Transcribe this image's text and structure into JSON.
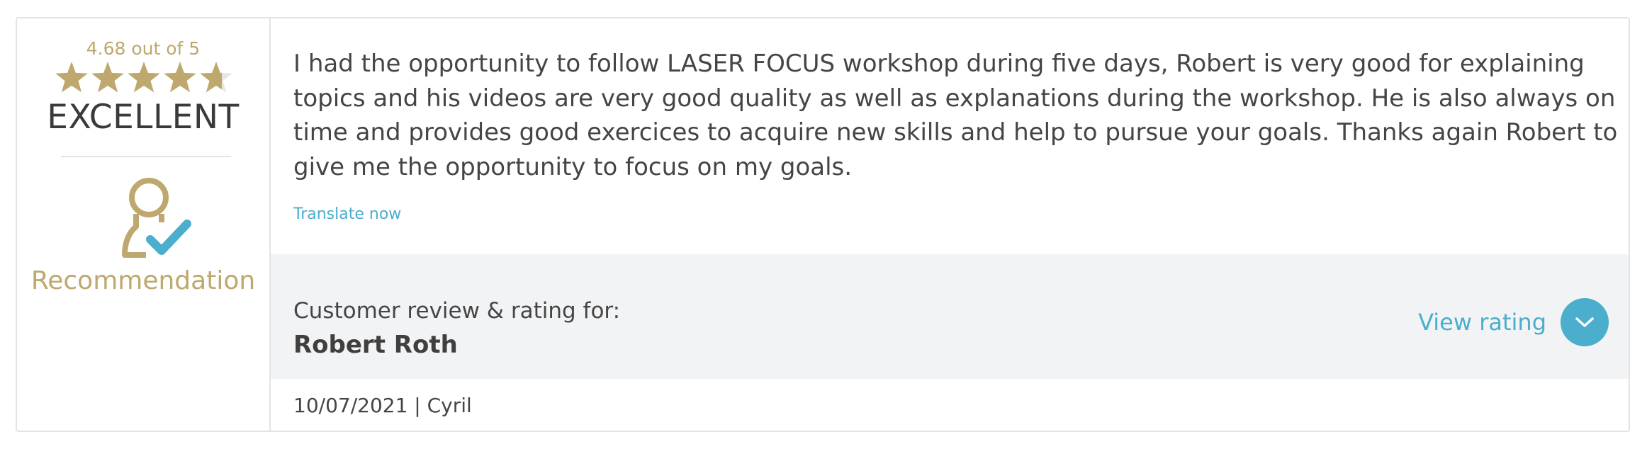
{
  "rating": {
    "score_text": "4.68 out of 5",
    "score": 4.68,
    "max": 5,
    "verdict": "EXCELLENT",
    "star_color": "#bea86e",
    "star_empty_color": "#e6e6e6"
  },
  "recommendation": {
    "label": "Recommendation",
    "icon": "person-check-icon",
    "color": "#bea86e",
    "check_color": "#4aaecc"
  },
  "review": {
    "text": "I had the opportunity to follow LASER FOCUS workshop during five days, Robert is very good for explaining topics and his videos are very good quality as well as explanations during the workshop. He is also always on time and provides good exercices to acquire new skills and help to pursue your goals. Thanks again Robert to give me the opportunity to focus on my goals.",
    "translate_label": "Translate now"
  },
  "subject": {
    "label": "Customer review & rating for:",
    "name": "Robert Roth",
    "view_rating_label": "View rating",
    "chevron_icon": "chevron-down-icon"
  },
  "meta": {
    "line": "10/07/2021 | Cyril"
  },
  "colors": {
    "accent": "#4aaecc",
    "gold": "#bea86e",
    "band_bg": "#f2f3f5",
    "border": "#e3e3e3"
  }
}
